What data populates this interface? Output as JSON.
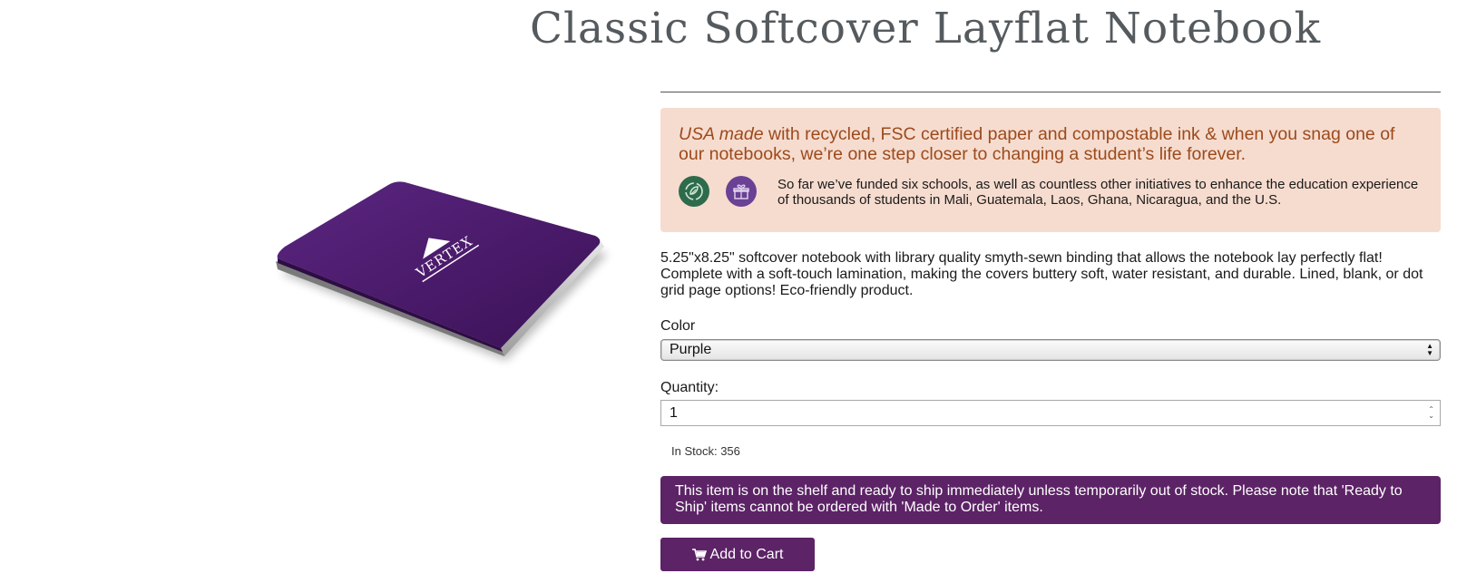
{
  "product": {
    "title": "Classic Softcover Layflat Notebook",
    "image_brand": "VERTEX",
    "image_color": "#4a1a6a"
  },
  "impact": {
    "headline_emphasis": "USA made",
    "headline_rest": " with recycled, FSC certified paper and compostable ink & when you snag one of our notebooks, we’re one step closer to changing a student’s life forever.",
    "body": "So far we’ve funded six schools, as well as countless other initiatives to enhance the education experience of thousands of students in Mali, Guatemala, Laos, Ghana, Nicaragua, and the U.S.",
    "icons": [
      "recycle-leaf-icon",
      "gift-heart-icon"
    ],
    "background": "#f6dccf",
    "headline_color": "#9c4a1c"
  },
  "description": "5.25\"x8.25\" softcover notebook with library quality smyth-sewn binding that allows the notebook lay perfectly flat! Complete with a soft-touch lamination, making the covers buttery soft, water resistant, and durable. Lined, blank, or dot grid page options! Eco-friendly product.",
  "options": {
    "color_label": "Color",
    "color_selected": "Purple",
    "quantity_label": "Quantity:",
    "quantity_value": "1"
  },
  "stock": {
    "text": "In Stock: 356"
  },
  "notice": {
    "text": "This item is on the shelf and ready to ship immediately unless temporarily out of stock. Please note that 'Ready to Ship' items cannot be ordered with 'Made to Order' items.",
    "background": "#5c2366"
  },
  "cart": {
    "button_label": "Add to Cart",
    "icon": "shopping-cart-icon"
  }
}
